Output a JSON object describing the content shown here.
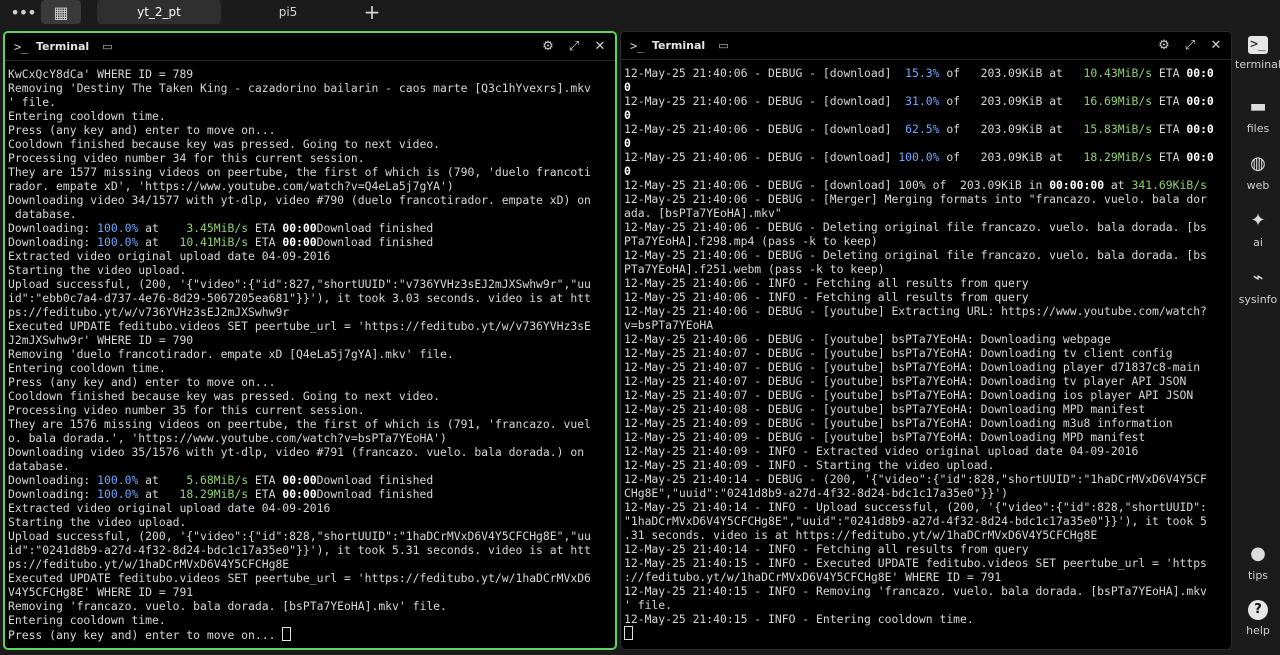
{
  "tabs": [
    {
      "label": "yt_2_pt",
      "active": true
    },
    {
      "label": "pi5",
      "active": false
    }
  ],
  "topbar": {
    "menu_glyph": "•••",
    "grid_glyph": "▦",
    "add_glyph": "+"
  },
  "panes": {
    "left": {
      "title": "Terminal",
      "icon": ">_"
    },
    "right": {
      "title": "Terminal",
      "icon": ">_"
    }
  },
  "header_icons": {
    "settings": "⚙",
    "expand": "⤢",
    "close": "✕",
    "monitor": "▭"
  },
  "left_terminal_lines": [
    "KwCxQcY8dCa' WHERE ID = 789",
    "Removing 'Destiny The Taken King - cazadorino bailarin - caos marte [Q3c1hYvexrs].mkv",
    "' file.",
    "Entering cooldown time.",
    "Press (any key and) enter to move on...",
    "Cooldown finished because key was pressed. Going to next video.",
    "Processing video number 34 for this current session.",
    "They are 1577 missing videos on peertube, the first of which is (790, 'duelo francoti",
    "rador. empate xD', 'https://www.youtube.com/watch?v=Q4eLa5j7gYA')",
    "Downloading video 34/1577 with yt-dlp, video #790 (duelo francotirador. empate xD) on",
    " database.",
    "Downloading: {{P}}100.0%{{/}} at    {{S}}3.45MiB/s{{/}} ETA {{B}}00:00{{/}}Download finished",
    "Downloading: {{P}}100.0%{{/}} at   {{S}}10.41MiB/s{{/}} ETA {{B}}00:00{{/}}Download finished",
    "Extracted video original upload date 04-09-2016",
    "Starting the video upload.",
    "Upload successful, (200, '{\"video\":{\"id\":827,\"shortUUID\":\"v736YVHz3sEJ2mJXSwhw9r\",\"uu",
    "id\":\"ebb0c7a4-d737-4e76-8d29-5067205ea681\"}}'), it took 3.03 seconds. video is at htt",
    "ps://feditubo.yt/w/v736YVHz3sEJ2mJXSwhw9r",
    "Executed UPDATE feditubo.videos SET peertube_url = 'https://feditubo.yt/w/v736YVHz3sE",
    "J2mJXSwhw9r' WHERE ID = 790",
    "Removing 'duelo francotirador. empate xD [Q4eLa5j7gYA].mkv' file.",
    "Entering cooldown time.",
    "Press (any key and) enter to move on...",
    "Cooldown finished because key was pressed. Going to next video.",
    "Processing video number 35 for this current session.",
    "They are 1576 missing videos on peertube, the first of which is (791, 'francazo. vuel",
    "o. bala dorada.', 'https://www.youtube.com/watch?v=bsPTa7YEoHA')",
    "Downloading video 35/1576 with yt-dlp, video #791 (francazo. vuelo. bala dorada.) on",
    "database.",
    "Downloading: {{P}}100.0%{{/}} at    {{S}}5.68MiB/s{{/}} ETA {{B}}00:00{{/}}Download finished",
    "Downloading: {{P}}100.0%{{/}} at   {{S}}18.29MiB/s{{/}} ETA {{B}}00:00{{/}}Download finished",
    "Extracted video original upload date 04-09-2016",
    "Starting the video upload.",
    "Upload successful, (200, '{\"video\":{\"id\":828,\"shortUUID\":\"1haDCrMVxD6V4Y5CFCHg8E\",\"uu",
    "id\":\"0241d8b9-a27d-4f32-8d24-bdc1c17a35e0\"}}'), it took 5.31 seconds. video is at htt",
    "ps://feditubo.yt/w/1haDCrMVxD6V4Y5CFCHg8E",
    "Executed UPDATE feditubo.videos SET peertube_url = 'https://feditubo.yt/w/1haDCrMVxD6",
    "V4Y5CFCHg8E' WHERE ID = 791",
    "Removing 'francazo. vuelo. bala dorada. [bsPTa7YEoHA].mkv' file.",
    "Entering cooldown time.",
    "Press (any key and) enter to move on... {{C}}"
  ],
  "right_terminal_lines": [
    "12-May-25 21:40:06 - DEBUG - [download]  {{P}}15.3%{{/}} of   203.09KiB at   {{S}}10.43MiB/s{{/}} ETA {{B}}00:0{{/}}",
    "{{B}}0{{/}}",
    "12-May-25 21:40:06 - DEBUG - [download]  {{P}}31.0%{{/}} of   203.09KiB at   {{S}}16.69MiB/s{{/}} ETA {{B}}00:0{{/}}",
    "{{B}}0{{/}}",
    "12-May-25 21:40:06 - DEBUG - [download]  {{P}}62.5%{{/}} of   203.09KiB at   {{S}}15.83MiB/s{{/}} ETA {{B}}00:0{{/}}",
    "{{B}}0{{/}}",
    "12-May-25 21:40:06 - DEBUG - [download] {{P}}100.0%{{/}} of   203.09KiB at   {{S}}18.29MiB/s{{/}} ETA {{B}}00:0{{/}}",
    "{{B}}0{{/}}",
    "12-May-25 21:40:06 - DEBUG - [download] 100% of  203.09KiB in {{B}}00:00:00{{/}} at {{S}}341.69KiB/s{{/}}",
    "12-May-25 21:40:06 - DEBUG - [Merger] Merging formats into \"francazo. vuelo. bala dor",
    "ada. [bsPTa7YEoHA].mkv\"",
    "12-May-25 21:40:06 - DEBUG - Deleting original file francazo. vuelo. bala dorada. [bs",
    "PTa7YEoHA].f298.mp4 (pass -k to keep)",
    "12-May-25 21:40:06 - DEBUG - Deleting original file francazo. vuelo. bala dorada. [bs",
    "PTa7YEoHA].f251.webm (pass -k to keep)",
    "12-May-25 21:40:06 - INFO - Fetching all results from query",
    "12-May-25 21:40:06 - INFO - Fetching all results from query",
    "12-May-25 21:40:06 - DEBUG - [youtube] Extracting URL: https://www.youtube.com/watch?",
    "v=bsPTa7YEoHA",
    "12-May-25 21:40:06 - DEBUG - [youtube] bsPTa7YEoHA: Downloading webpage",
    "12-May-25 21:40:07 - DEBUG - [youtube] bsPTa7YEoHA: Downloading tv client config",
    "12-May-25 21:40:07 - DEBUG - [youtube] bsPTa7YEoHA: Downloading player d71837c8-main",
    "12-May-25 21:40:07 - DEBUG - [youtube] bsPTa7YEoHA: Downloading tv player API JSON",
    "12-May-25 21:40:07 - DEBUG - [youtube] bsPTa7YEoHA: Downloading ios player API JSON",
    "12-May-25 21:40:08 - DEBUG - [youtube] bsPTa7YEoHA: Downloading MPD manifest",
    "12-May-25 21:40:09 - DEBUG - [youtube] bsPTa7YEoHA: Downloading m3u8 information",
    "12-May-25 21:40:09 - DEBUG - [youtube] bsPTa7YEoHA: Downloading MPD manifest",
    "12-May-25 21:40:09 - INFO - Extracted video original upload date 04-09-2016",
    "12-May-25 21:40:09 - INFO - Starting the video upload.",
    "12-May-25 21:40:14 - DEBUG - (200, '{\"video\":{\"id\":828,\"shortUUID\":\"1haDCrMVxD6V4Y5CF",
    "CHg8E\",\"uuid\":\"0241d8b9-a27d-4f32-8d24-bdc1c17a35e0\"}}')",
    "12-May-25 21:40:14 - INFO - Upload successful, (200, '{\"video\":{\"id\":828,\"shortUUID\":",
    "\"1haDCrMVxD6V4Y5CFCHg8E\",\"uuid\":\"0241d8b9-a27d-4f32-8d24-bdc1c17a35e0\"}}'), it took 5",
    ".31 seconds. video is at https://feditubo.yt/w/1haDCrMVxD6V4Y5CFCHg8E",
    "12-May-25 21:40:14 - INFO - Fetching all results from query",
    "12-May-25 21:40:15 - INFO - Executed UPDATE feditubo.videos SET peertube_url = 'https",
    "://feditubo.yt/w/1haDCrMVxD6V4Y5CFCHg8E' WHERE ID = 791",
    "12-May-25 21:40:15 - INFO - Removing 'francazo. vuelo. bala dorada. [bsPTa7YEoHA].mkv",
    "' file.",
    "12-May-25 21:40:15 - INFO - Entering cooldown time.",
    "{{C}}"
  ],
  "sidebar": [
    {
      "label": "terminal",
      "icon": "terminal-icon",
      "glyph": ">_"
    },
    {
      "label": "files",
      "icon": "folder-icon",
      "glyph": "▬"
    },
    {
      "label": "web",
      "icon": "globe-icon",
      "glyph": "◍"
    },
    {
      "label": "ai",
      "icon": "sparkle-icon",
      "glyph": "✦"
    },
    {
      "label": "sysinfo",
      "icon": "chart-icon",
      "glyph": "⌁"
    },
    {
      "label": "tips",
      "icon": "lightbulb-icon",
      "glyph": "●"
    },
    {
      "label": "help",
      "icon": "help-icon",
      "glyph": "?"
    }
  ],
  "colors": {
    "active_border": "#5fd35f",
    "percent": "#6fa8ff",
    "speed": "#8fd26f",
    "background": "#000000"
  }
}
